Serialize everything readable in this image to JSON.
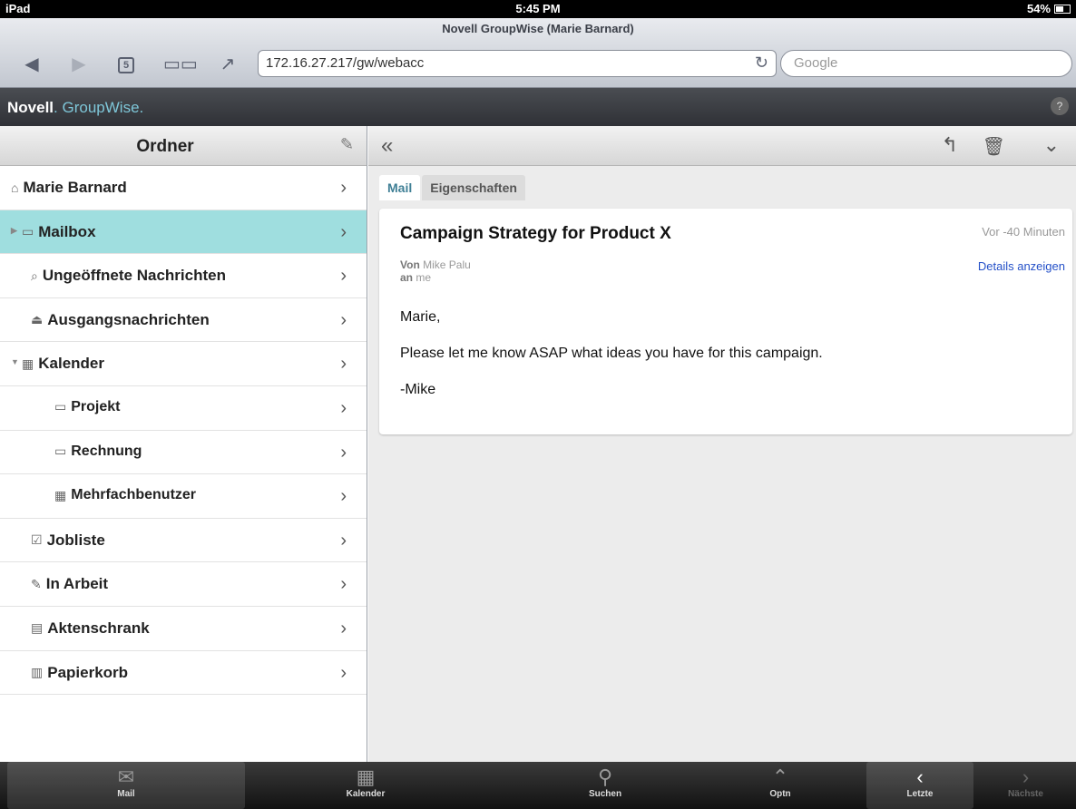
{
  "statusbar": {
    "device": "iPad",
    "time": "5:45 PM",
    "battery": "54%"
  },
  "browser": {
    "page_title": "Novell GroupWise (Marie Barnard)",
    "tab_count": "5",
    "url": "172.16.27.217/gw/webacc",
    "search_placeholder": "Google"
  },
  "app": {
    "brand_novell": "Novell",
    "brand_groupwise": "GroupWise",
    "brand_dot": ".",
    "help": "?"
  },
  "folders": {
    "title": "Ordner",
    "items": [
      {
        "label": "Marie Barnard",
        "icon": "home-icon"
      },
      {
        "label": "Mailbox",
        "icon": "mailbox-icon",
        "selected": true
      },
      {
        "label": "Ungeöffnete Nachrichten",
        "icon": "unopened-icon"
      },
      {
        "label": "Ausgangsnachrichten",
        "icon": "outbox-icon"
      },
      {
        "label": "Kalender",
        "icon": "calendar-icon"
      },
      {
        "label": "Projekt",
        "icon": "folder-icon"
      },
      {
        "label": "Rechnung",
        "icon": "folder-icon"
      },
      {
        "label": "Mehrfachbenutzer",
        "icon": "calendar-icon"
      },
      {
        "label": "Jobliste",
        "icon": "checklist-icon"
      },
      {
        "label": "In Arbeit",
        "icon": "draft-icon"
      },
      {
        "label": "Aktenschrank",
        "icon": "cabinet-icon"
      },
      {
        "label": "Papierkorb",
        "icon": "trash-icon"
      }
    ]
  },
  "message": {
    "tabs": [
      "Mail",
      "Eigenschaften"
    ],
    "subject": "Campaign Strategy for Product X",
    "time": "Vor -40 Minuten",
    "details_link": "Details anzeigen",
    "from_label": "Von",
    "from": "Mike Palu",
    "to_label": "an",
    "to": "me",
    "body": [
      "Marie,",
      "Please let me know ASAP what ideas you have for this campaign.",
      "-Mike"
    ]
  },
  "tabbar": [
    {
      "label": "Mail",
      "icon": "mail-icon",
      "active": true
    },
    {
      "label": "Kalender",
      "icon": "calendar-grid-icon"
    },
    {
      "label": "Suchen",
      "icon": "search-icon"
    },
    {
      "label": "Optn",
      "icon": "double-chevron-up-icon"
    },
    {
      "label": "Letzte",
      "icon": "chevron-left-icon"
    },
    {
      "label": "Nächste",
      "icon": "chevron-right-icon",
      "disabled": true
    }
  ],
  "colors": {
    "selected_row": "#9fdedf",
    "brand_accent": "#7ec6d8",
    "link": "#2450c8"
  }
}
